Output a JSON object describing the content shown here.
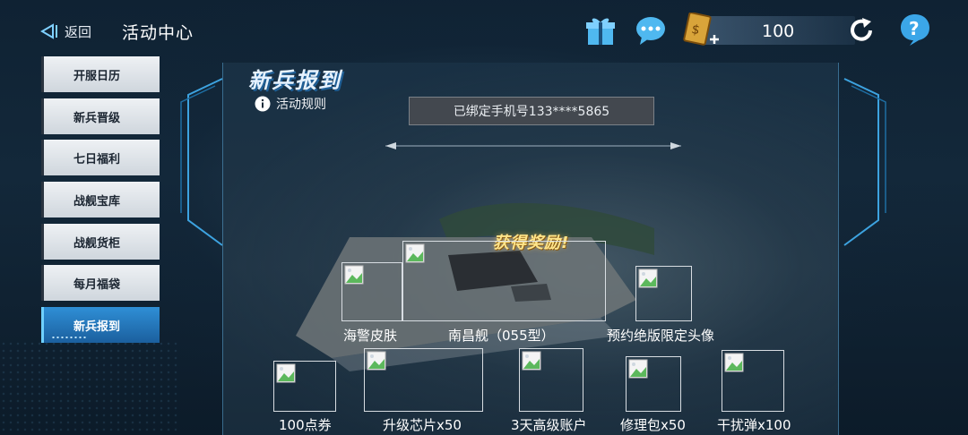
{
  "header": {
    "back_label": "返回",
    "title": "活动中心",
    "currency_value": "100",
    "icons": [
      "back-arrow-icon",
      "gift-icon",
      "chat-icon",
      "currency-card-icon",
      "refresh-icon",
      "help-icon"
    ]
  },
  "sidebar": {
    "items": [
      {
        "label": "开服日历"
      },
      {
        "label": "新兵晋级"
      },
      {
        "label": "七日福利"
      },
      {
        "label": "战舰宝库"
      },
      {
        "label": "战舰货柜"
      },
      {
        "label": "每月福袋"
      },
      {
        "label": "新兵报到",
        "active": true
      }
    ]
  },
  "event": {
    "title": "新兵报到",
    "rules_label": "活动规则",
    "bound_phone_text": "已绑定手机号133****5865",
    "reward_title": "获得奖励!"
  },
  "rewards": [
    {
      "label": "海警皮肤"
    },
    {
      "label": "南昌舰（055型）"
    },
    {
      "label": "预约绝版限定头像"
    },
    {
      "label": "100点券"
    },
    {
      "label": "升级芯片x50"
    },
    {
      "label": "3天高级账户"
    },
    {
      "label": "修理包x50"
    },
    {
      "label": "干扰弹x100"
    }
  ],
  "colors": {
    "active_tab": "#2f8fd6",
    "reward_title": "#ffe58a",
    "help_icon": "#3ba6e8"
  }
}
